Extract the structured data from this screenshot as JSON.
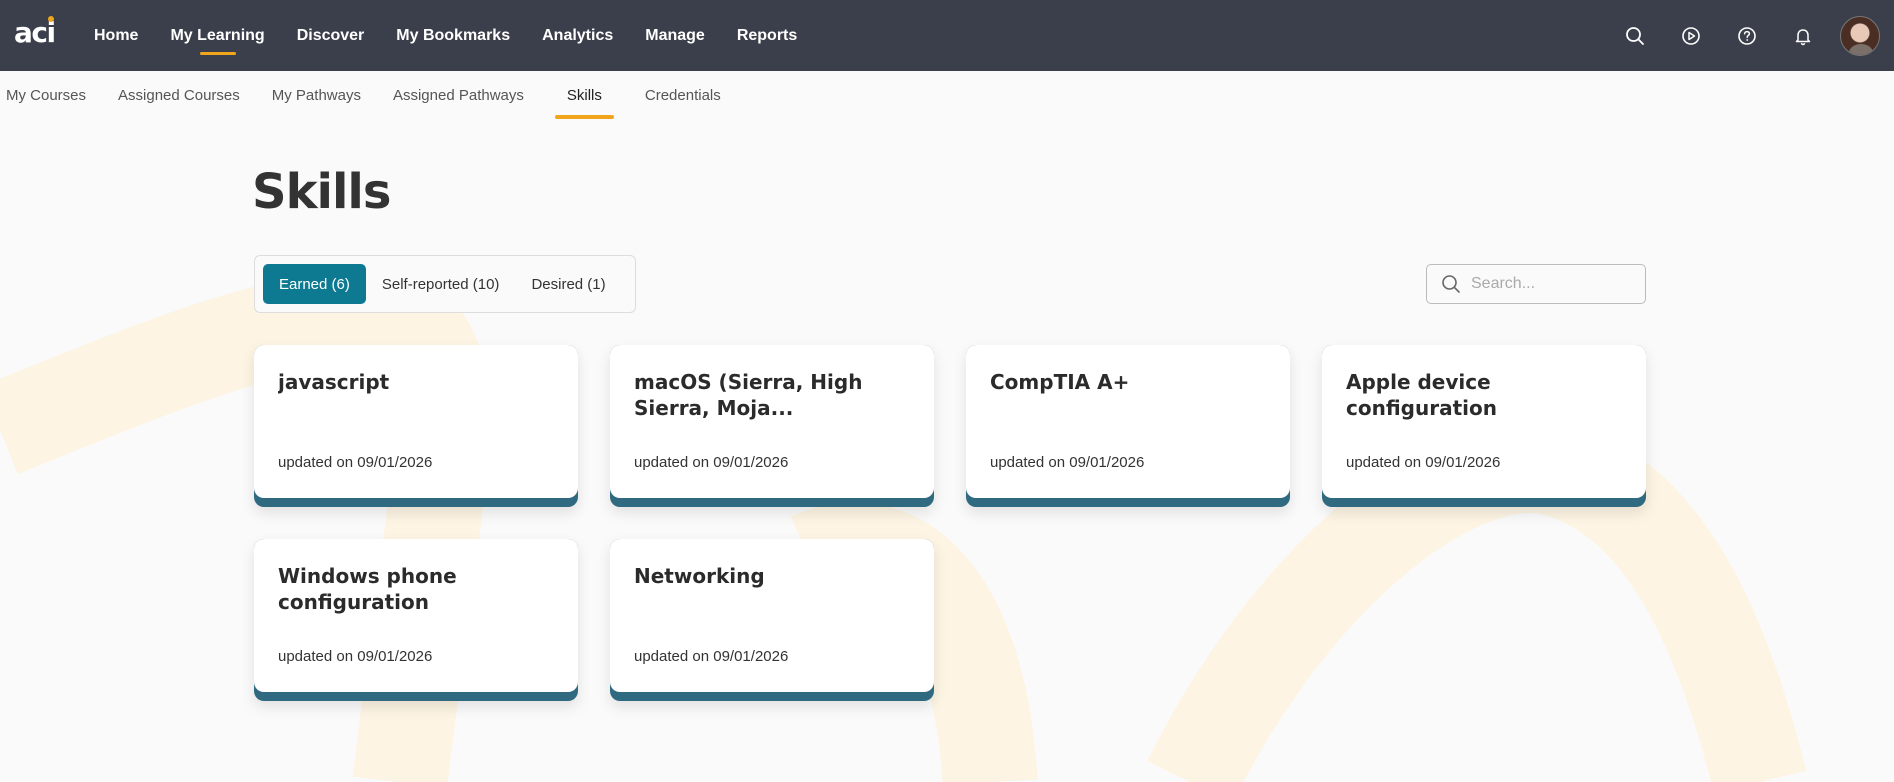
{
  "app": {
    "logo_text": "aci"
  },
  "nav": {
    "items": [
      {
        "label": "Home",
        "active": false
      },
      {
        "label": "My Learning",
        "active": true
      },
      {
        "label": "Discover",
        "active": false
      },
      {
        "label": "My Bookmarks",
        "active": false
      },
      {
        "label": "Analytics",
        "active": false
      },
      {
        "label": "Manage",
        "active": false
      },
      {
        "label": "Reports",
        "active": false
      }
    ],
    "icons": [
      "search-icon",
      "play-icon",
      "help-icon",
      "bell-icon"
    ]
  },
  "subnav": {
    "items": [
      {
        "label": "My Courses",
        "active": false
      },
      {
        "label": "Assigned Courses",
        "active": false
      },
      {
        "label": "My Pathways",
        "active": false
      },
      {
        "label": "Assigned Pathways",
        "active": false
      },
      {
        "label": "Skills",
        "active": true
      },
      {
        "label": "Credentials",
        "active": false
      }
    ]
  },
  "page": {
    "title": "Skills"
  },
  "filters": {
    "tabs": [
      {
        "label": "Earned (6)",
        "active": true
      },
      {
        "label": "Self-reported (10)",
        "active": false
      },
      {
        "label": "Desired (1)",
        "active": false
      }
    ]
  },
  "search": {
    "placeholder": "Search...",
    "value": ""
  },
  "skills": [
    {
      "name": "javascript",
      "updated": "updated on 09/01/2026"
    },
    {
      "name": "macOS (Sierra, High Sierra, Moja...",
      "updated": "updated on 09/01/2026"
    },
    {
      "name": "CompTIA A+",
      "updated": "updated on 09/01/2026"
    },
    {
      "name": "Apple device configuration",
      "updated": "updated on 09/01/2026"
    },
    {
      "name": "Windows phone configuration",
      "updated": "updated on 09/01/2026"
    },
    {
      "name": "Networking",
      "updated": "updated on 09/01/2026"
    }
  ],
  "colors": {
    "topbar": "#3a3f4b",
    "accent": "#f0a51d",
    "primary": "#0e7a91",
    "card_border": "#2f6a80"
  }
}
